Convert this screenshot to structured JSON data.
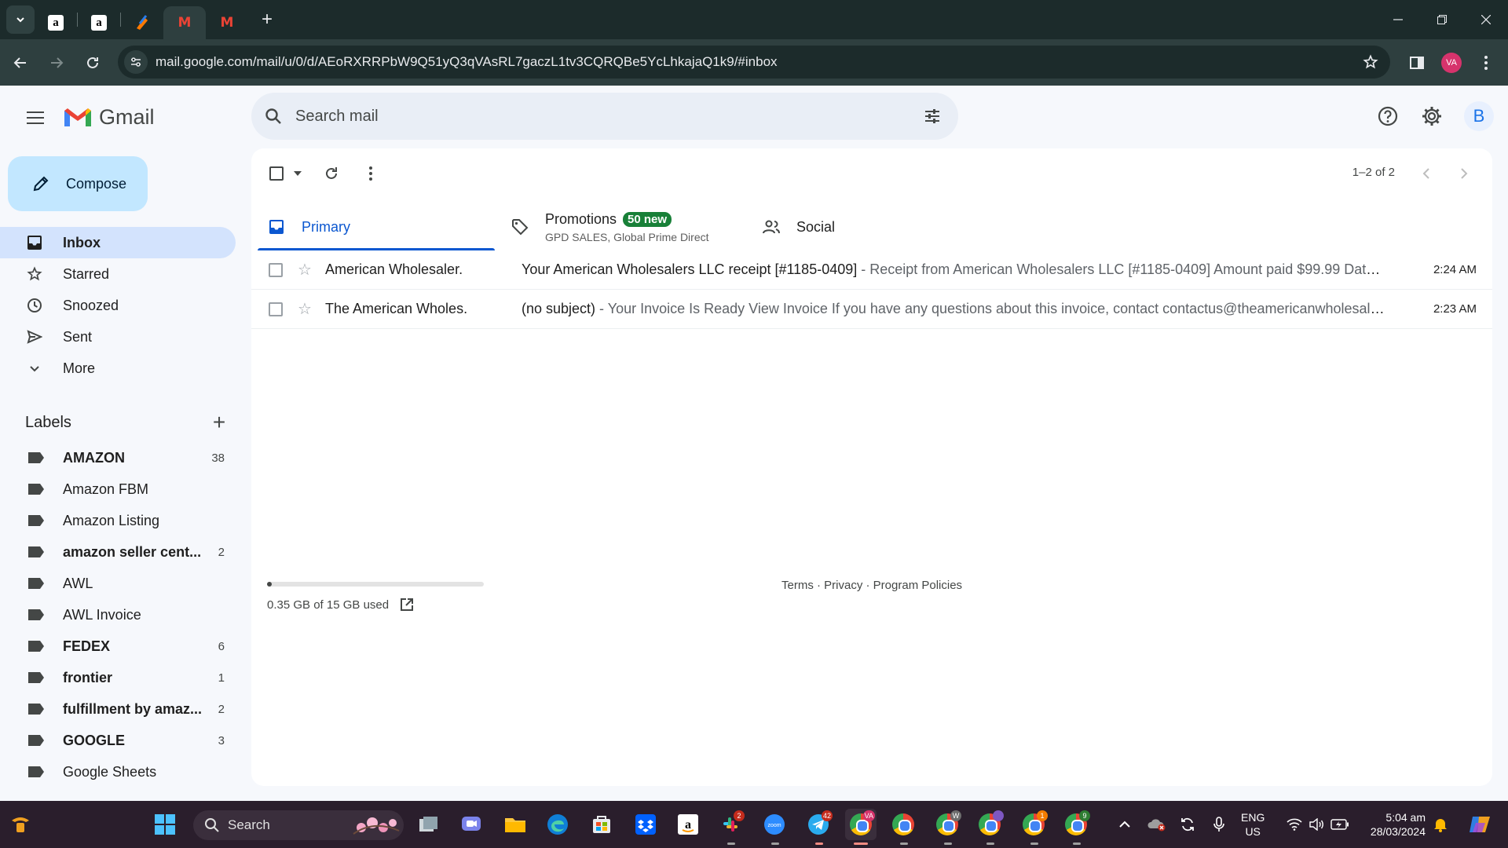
{
  "browser": {
    "tabs": [
      {
        "icon": "amazon-icon",
        "glyph": "a"
      },
      {
        "icon": "amazon-icon",
        "glyph": "a"
      },
      {
        "icon": "app-icon",
        "glyph": ""
      },
      {
        "icon": "gmail-icon",
        "glyph": "M",
        "active": true
      },
      {
        "icon": "gmail-icon",
        "glyph": "M"
      }
    ],
    "new_tab": "+",
    "url": "mail.google.com/mail/u/0/d/AEoRXRRPbW9Q51yQ3qVAsRL7gaczL1tv3CQRQBe5YcLhkajaQ1k9/#inbox",
    "profile_initials": "VA"
  },
  "gmail": {
    "logo_text": "Gmail",
    "search_placeholder": "Search mail",
    "avatar_initial": "B",
    "compose_label": "Compose",
    "nav": [
      {
        "label": "Inbox",
        "icon": "inbox-icon",
        "active": true
      },
      {
        "label": "Starred",
        "icon": "star-icon"
      },
      {
        "label": "Snoozed",
        "icon": "clock-icon"
      },
      {
        "label": "Sent",
        "icon": "send-icon"
      },
      {
        "label": "More",
        "icon": "chevron-down-icon"
      }
    ],
    "labels_title": "Labels",
    "labels": [
      {
        "name": "AMAZON",
        "count": "38",
        "bold": true
      },
      {
        "name": "Amazon FBM",
        "count": "",
        "bold": false
      },
      {
        "name": "Amazon Listing",
        "count": "",
        "bold": false
      },
      {
        "name": "amazon seller cent...",
        "count": "2",
        "bold": true
      },
      {
        "name": "AWL",
        "count": "",
        "bold": false
      },
      {
        "name": "AWL Invoice",
        "count": "",
        "bold": false
      },
      {
        "name": "FEDEX",
        "count": "6",
        "bold": true
      },
      {
        "name": "frontier",
        "count": "1",
        "bold": true
      },
      {
        "name": "fulfillment by amaz...",
        "count": "2",
        "bold": true
      },
      {
        "name": "GOOGLE",
        "count": "3",
        "bold": true
      },
      {
        "name": "Google Sheets",
        "count": "",
        "bold": false
      }
    ],
    "pager": "1–2 of 2",
    "tabs": {
      "primary": "Primary",
      "promotions": "Promotions",
      "promotions_badge": "50 new",
      "promotions_sub": "GPD SALES, Global Prime Direct",
      "social": "Social"
    },
    "emails": [
      {
        "sender": "American Wholesaler.",
        "subject": "Your American Wholesalers LLC receipt [#1185-0409]",
        "snippet": " - Receipt from American Wholesalers LLC [#1185-0409] Amount paid $99.99 Date ...",
        "time": "2:24 AM"
      },
      {
        "sender": "The American Wholes.",
        "subject": "(no subject)",
        "snippet": " - Your Invoice Is Ready View Invoice If you have any questions about this invoice, contact contactus@theamericanwholesaler...",
        "time": "2:23 AM"
      }
    ],
    "storage": {
      "text": "0.35 GB of 15 GB used",
      "used_fraction": 0.023
    },
    "footer": "Terms · Privacy · Program Policies"
  },
  "taskbar": {
    "search_label": "Search",
    "badges": {
      "slack": "2",
      "telegram": "42",
      "chrome_va": "VA",
      "chrome_w": "W",
      "chrome_4": "1",
      "chrome_9": "9"
    },
    "lang_line1": "ENG",
    "lang_line2": "US",
    "time": "5:04 am",
    "date": "28/03/2024"
  },
  "colors": {
    "accent": "#0b57d0",
    "compose_bg": "#c2e7ff",
    "active_nav": "#d3e3fd",
    "badge_green": "#188038"
  }
}
